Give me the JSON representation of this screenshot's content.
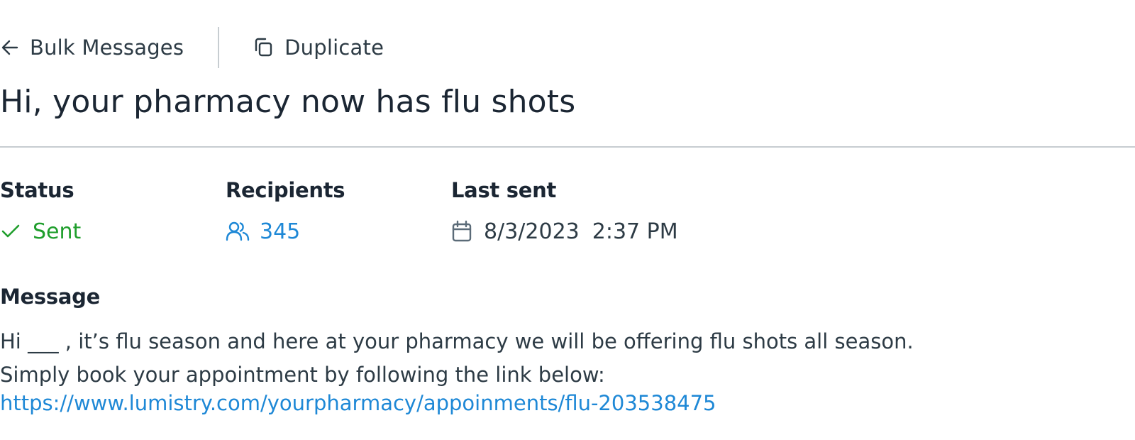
{
  "nav": {
    "back_label": "Bulk Messages",
    "back_icon": "arrow-left-icon",
    "duplicate_label": "Duplicate",
    "duplicate_icon": "duplicate-icon"
  },
  "page": {
    "title": "Hi, your pharmacy now has flu shots"
  },
  "details": {
    "status": {
      "label": "Status",
      "value": "Sent",
      "icon": "check-icon",
      "color": "#1f9e2c"
    },
    "recipients": {
      "label": "Recipients",
      "value": "345",
      "icon": "users-icon",
      "color": "#1e88d6"
    },
    "last_sent": {
      "label": "Last sent",
      "date": "8/3/2023",
      "time": "2:37 PM",
      "icon": "calendar-icon"
    }
  },
  "message": {
    "label": "Message",
    "body": "Hi ___ , it’s flu season and here at your pharmacy we will be offering flu shots all season. Simply book your appointment by following the link below:",
    "link": "https://www.lumistry.com/yourpharmacy/appoinments/flu-203538475"
  },
  "colors": {
    "text_primary": "#1b2633",
    "text_secondary": "#2d3b45",
    "link": "#1e88d6",
    "success": "#1f9e2c",
    "divider": "#c7cdd1"
  }
}
